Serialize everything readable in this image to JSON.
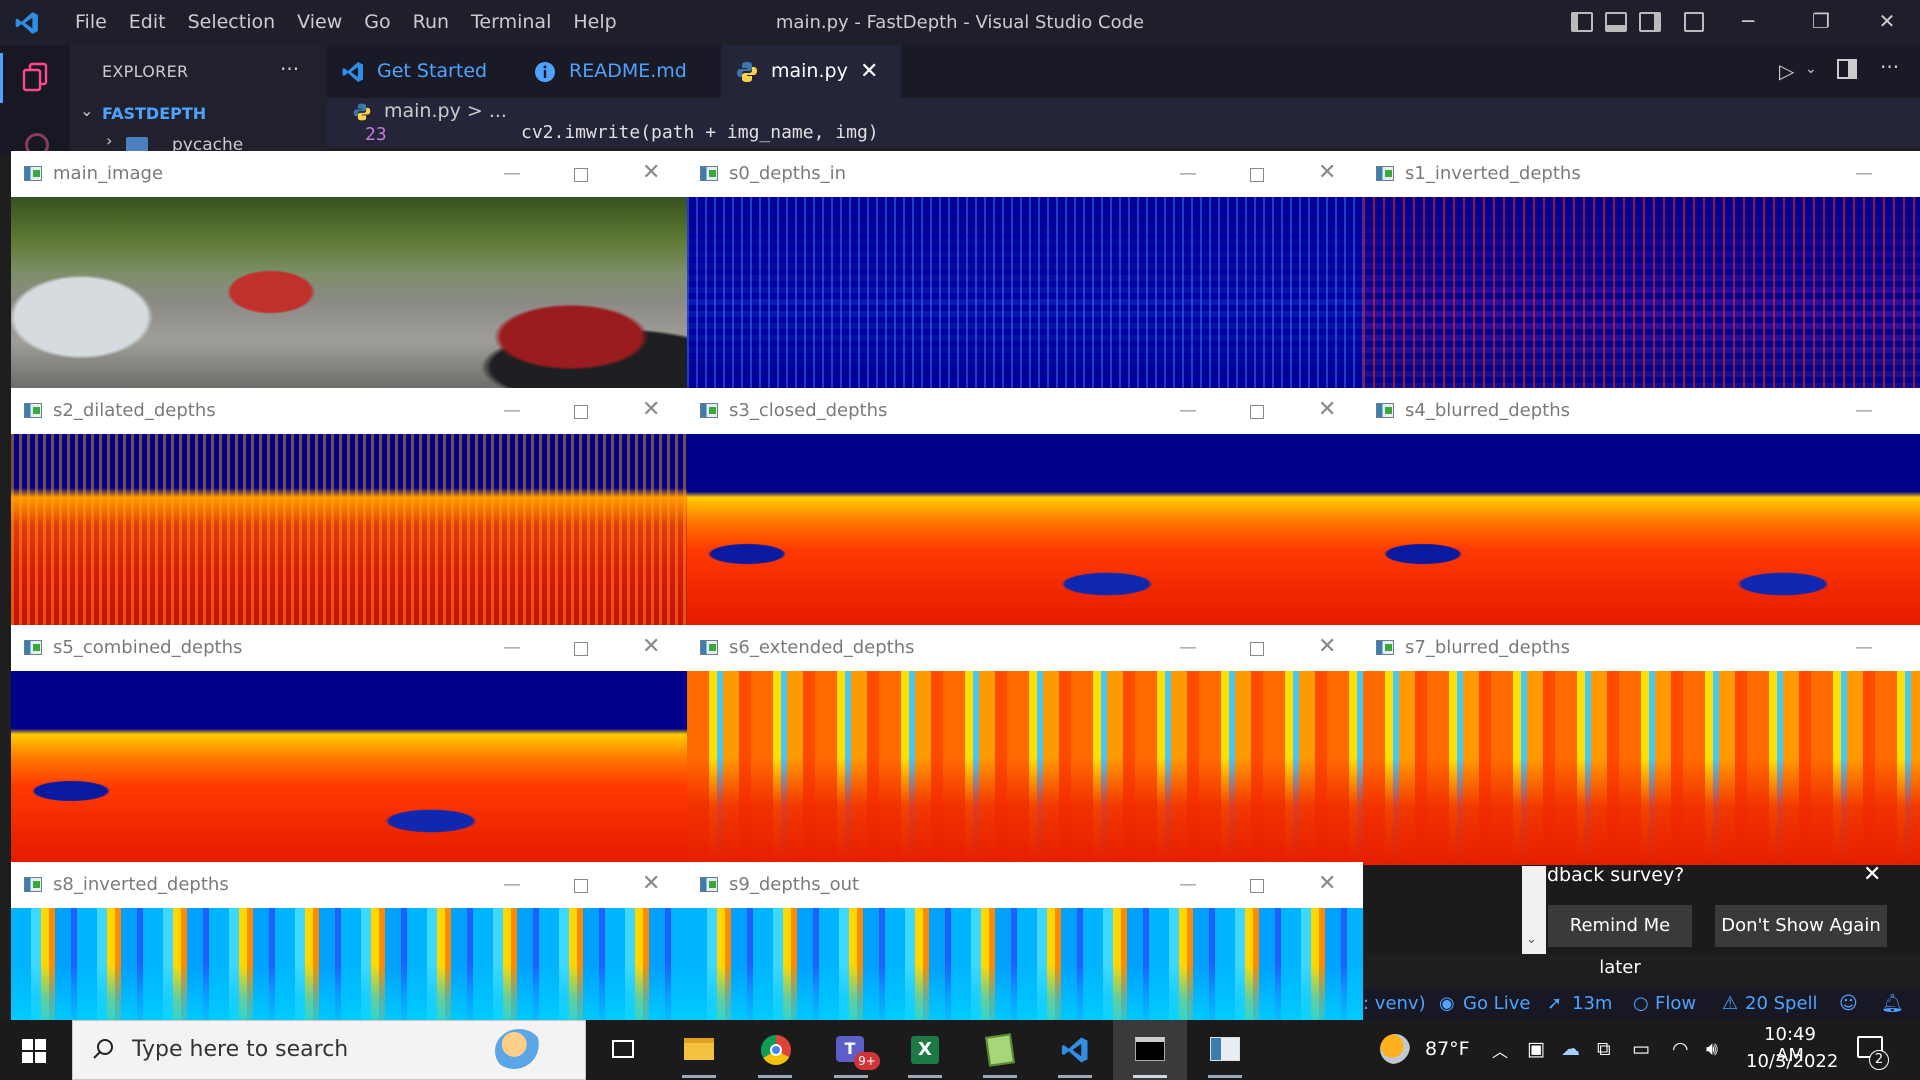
{
  "vscode": {
    "window_title": "main.py - FastDepth - Visual Studio Code",
    "menu": [
      "File",
      "Edit",
      "Selection",
      "View",
      "Go",
      "Run",
      "Terminal",
      "Help"
    ],
    "explorer_title": "EXPLORER",
    "explorer_more": "···",
    "folder": "FASTDEPTH",
    "folder_item": "pycache",
    "tabs": [
      {
        "label": "Get Started",
        "icon": "vscode-icon"
      },
      {
        "label": "README.md",
        "icon": "info-icon"
      },
      {
        "label": "main.py",
        "icon": "python-icon",
        "active": true
      }
    ],
    "tab_close": "✕",
    "breadcrumb": "main.py > ...",
    "code_line_number": "23",
    "code_line_text": "cv2.imwrite(path + img_name, img)",
    "colors": {
      "accent": "#4fa3ff",
      "editor_bg": "#25253a",
      "titlebar_bg": "#1f1f2b"
    }
  },
  "windows": [
    {
      "title": "main_image",
      "texture": "photo"
    },
    {
      "title": "s0_depths_in",
      "texture": "sparse-blue"
    },
    {
      "title": "s1_inverted_depths",
      "texture": "sparse-red"
    },
    {
      "title": "s2_dilated_depths",
      "texture": "dilated"
    },
    {
      "title": "s3_closed_depths",
      "texture": "closed"
    },
    {
      "title": "s4_blurred_depths",
      "texture": "closed"
    },
    {
      "title": "s5_combined_depths",
      "texture": "closed"
    },
    {
      "title": "s6_extended_depths",
      "texture": "stripes-warm"
    },
    {
      "title": "s7_blurred_depths",
      "texture": "stripes-warm2"
    },
    {
      "title": "s8_inverted_depths",
      "texture": "stripes-cool"
    },
    {
      "title": "s9_depths_out",
      "texture": "stripes-cool"
    }
  ],
  "notification": {
    "text": "dback survey?",
    "remind_label": "Remind Me later",
    "dont_show_label": "Don't Show Again",
    "close": "✕"
  },
  "statusbar": {
    "venv": ": venv)",
    "go_live": "Go Live",
    "timer": "13m",
    "flow": "Flow",
    "spell": "20 Spell"
  },
  "taskbar": {
    "search_placeholder": "Type here to search",
    "weather": "87°F",
    "time": "10:49 AM",
    "date": "10/3/2022",
    "notification_count": "2",
    "teams_badge": "9+",
    "apps": [
      "task-view",
      "file-explorer",
      "chrome",
      "teams",
      "excel",
      "notepad-plus-plus",
      "vscode",
      "terminal",
      "opencv-window"
    ]
  }
}
